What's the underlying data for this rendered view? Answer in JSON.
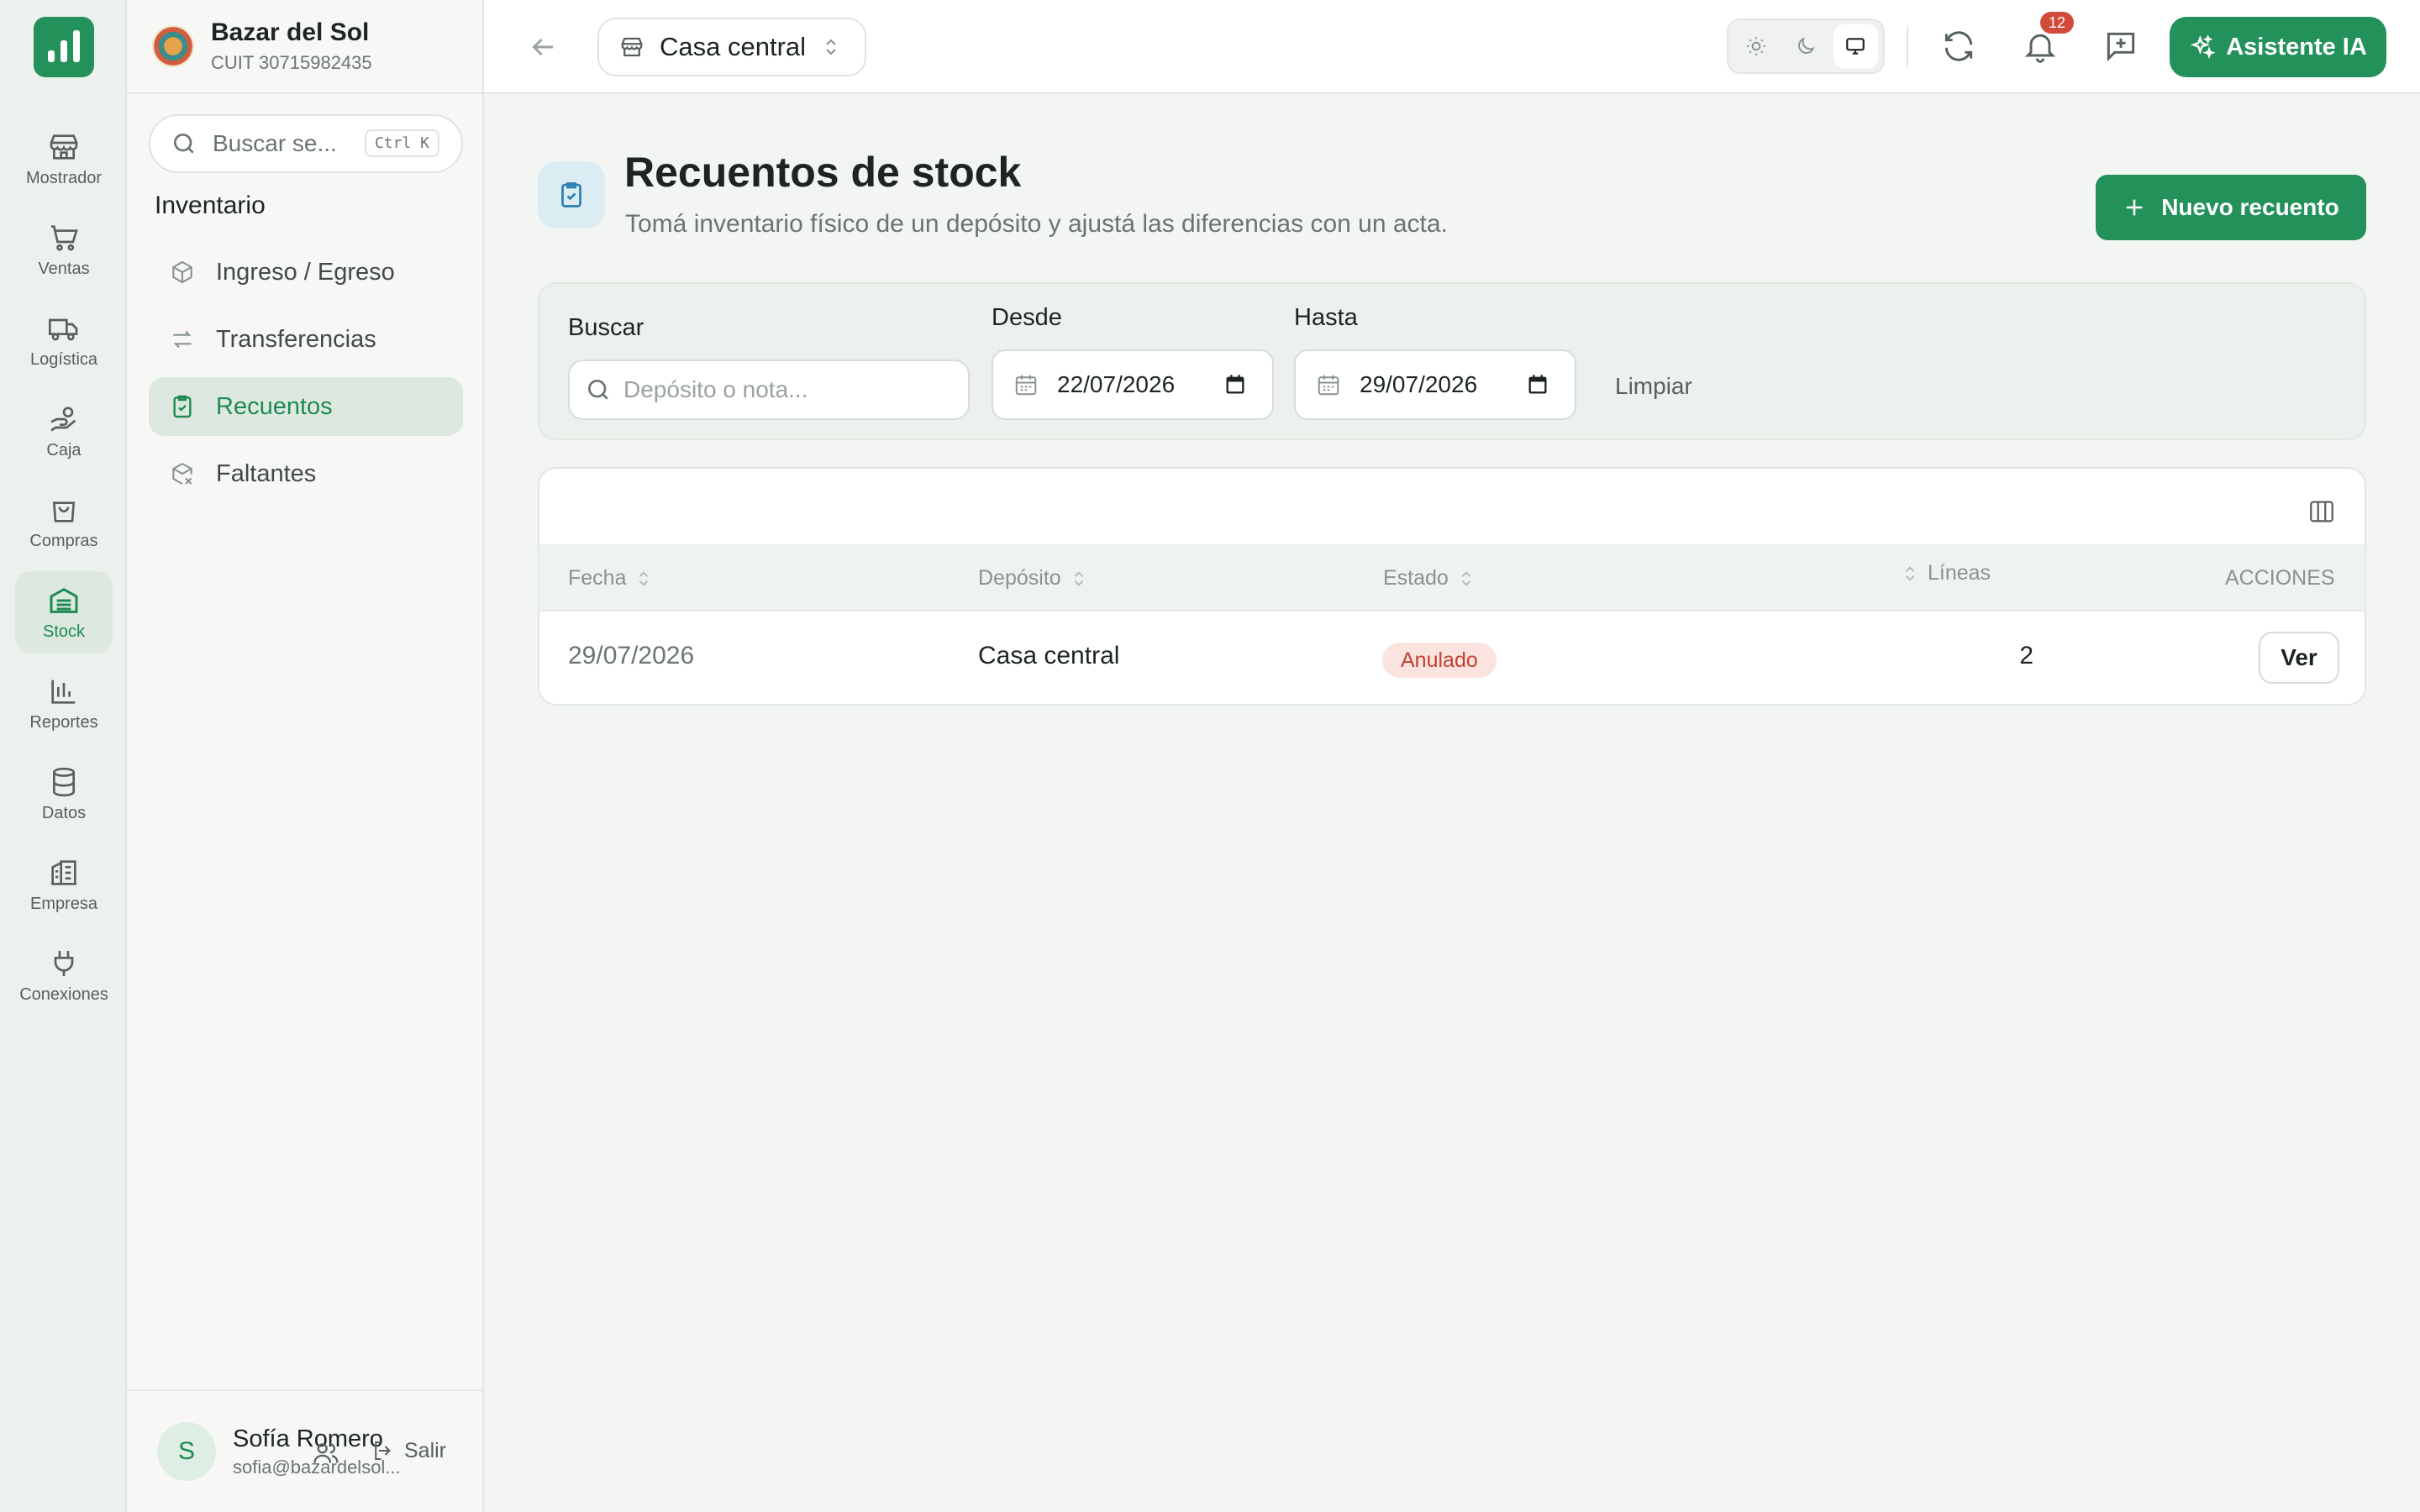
{
  "rail": {
    "items": [
      {
        "label": "Mostrador",
        "icon": "store-icon"
      },
      {
        "label": "Ventas",
        "icon": "cart-icon"
      },
      {
        "label": "Logística",
        "icon": "truck-icon"
      },
      {
        "label": "Caja",
        "icon": "hand-coins-icon"
      },
      {
        "label": "Compras",
        "icon": "shopping-bag-icon"
      },
      {
        "label": "Stock",
        "icon": "warehouse-icon",
        "active": true
      },
      {
        "label": "Reportes",
        "icon": "bar-chart-icon"
      },
      {
        "label": "Datos",
        "icon": "database-icon"
      },
      {
        "label": "Empresa",
        "icon": "building-icon"
      },
      {
        "label": "Conexiones",
        "icon": "plug-icon"
      }
    ]
  },
  "brand": {
    "name": "Bazar del Sol",
    "cuit": "CUIT 30715982435"
  },
  "sidebar": {
    "search_placeholder": "Buscar se...",
    "shortcut": "Ctrl K",
    "heading": "Inventario",
    "items": [
      {
        "label": "Ingreso / Egreso",
        "icon": "package-icon"
      },
      {
        "label": "Transferencias",
        "icon": "arrows-left-right-icon"
      },
      {
        "label": "Recuentos",
        "icon": "clipboard-check-icon",
        "active": true
      },
      {
        "label": "Faltantes",
        "icon": "package-x-icon"
      }
    ]
  },
  "user": {
    "initial": "S",
    "name": "Sofía Romero",
    "email": "sofia@bazardelsol...",
    "logout": "Salir"
  },
  "topbar": {
    "store": "Casa central",
    "notifications": "12",
    "ai_button": "Asistente IA",
    "theme_selected": "system"
  },
  "page": {
    "title": "Recuentos de stock",
    "subtitle": "Tomá inventario físico de un depósito y ajustá las diferencias con un acta.",
    "new_button": "Nuevo recuento"
  },
  "filters": {
    "search_label": "Buscar",
    "search_placeholder": "Depósito o nota...",
    "from_label": "Desde",
    "from_value": "22/07/2026",
    "to_label": "Hasta",
    "to_value": "29/07/2026",
    "clear": "Limpiar"
  },
  "table": {
    "columns": [
      "Fecha",
      "Depósito",
      "Estado",
      "Líneas",
      "ACCIONES"
    ],
    "rows": [
      {
        "fecha": "29/07/2026",
        "deposito": "Casa central",
        "estado": "Anulado",
        "lineas": "2",
        "accion": "Ver"
      }
    ]
  },
  "colors": {
    "accent": "#23915a",
    "status_anulado": "#c2412f",
    "badge": "#d24a3a"
  }
}
